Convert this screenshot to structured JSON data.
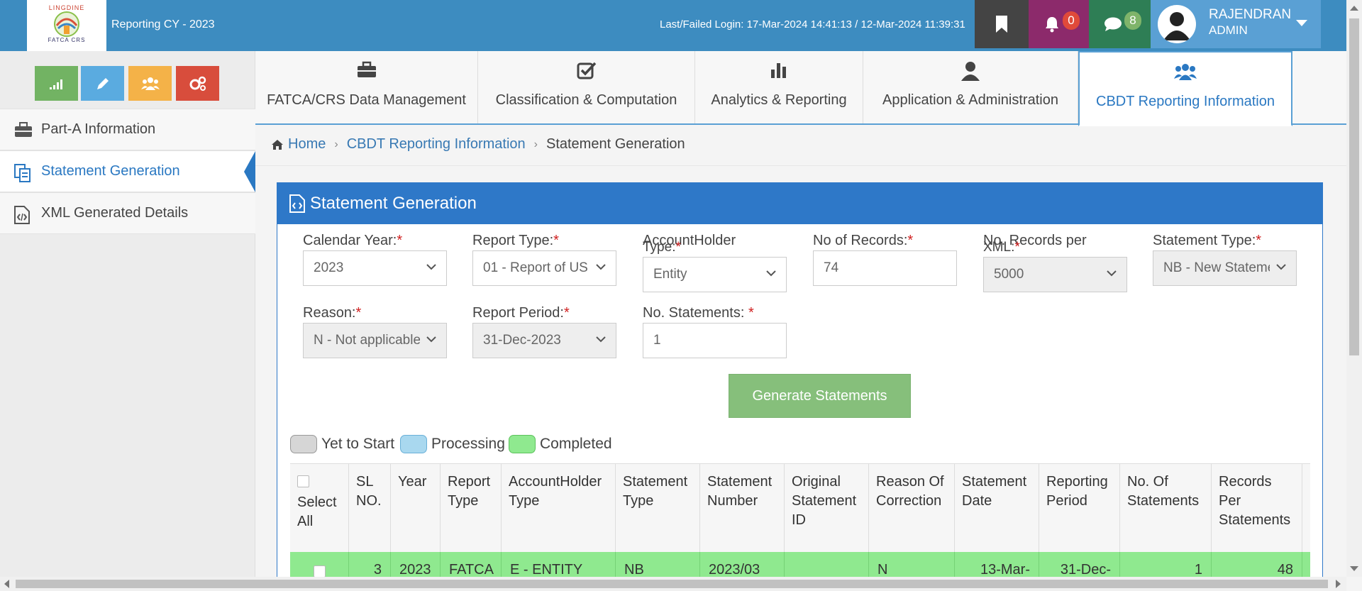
{
  "header": {
    "title": "Reporting CY - 2023",
    "login_info": "Last/Failed Login: 17-Mar-2024 14:41:13 / 12-Mar-2024 11:39:31",
    "notifications_count": "0",
    "messages_count": "8",
    "user_name": "RAJENDRAN",
    "user_role": "ADMIN",
    "logo_text_top": "LINGDINE",
    "logo_text_bottom": "FATCA CRS"
  },
  "sidebar": {
    "quick_buttons": [
      "chart-icon",
      "pencil-icon",
      "users-icon",
      "gears-icon"
    ],
    "items": [
      {
        "label": "Part-A Information",
        "icon": "briefcase-icon"
      },
      {
        "label": "Statement Generation",
        "icon": "documents-icon"
      },
      {
        "label": "XML Generated Details",
        "icon": "code-file-icon"
      }
    ]
  },
  "nav": {
    "tabs": [
      {
        "label": "FATCA/CRS Data Management",
        "icon": "briefcase-icon"
      },
      {
        "label": "Classification & Computation",
        "icon": "check-square-icon"
      },
      {
        "label": "Analytics & Reporting",
        "icon": "bar-chart-icon"
      },
      {
        "label": "Application & Administration",
        "icon": "user-icon"
      },
      {
        "label": "CBDT Reporting Information",
        "icon": "users-icon"
      }
    ]
  },
  "breadcrumb": {
    "home": "Home",
    "section": "CBDT Reporting Information",
    "current": "Statement Generation"
  },
  "panel": {
    "title": "Statement Generation",
    "fields": {
      "calendar_year": {
        "label": "Calendar Year:",
        "value": "2023"
      },
      "report_type": {
        "label": "Report Type:",
        "value": "01 - Report of US"
      },
      "accountholder_type": {
        "label_line1": "AccountHolder",
        "label_line2": "Type:",
        "value": "Entity"
      },
      "no_of_records": {
        "label": "No of Records:",
        "value": "74"
      },
      "records_per_xml": {
        "label_line1": "No. Records per",
        "label_line2": "XML:",
        "value": "5000"
      },
      "statement_type": {
        "label": "Statement Type:",
        "value": "NB - New Statement"
      },
      "reason": {
        "label": "Reason:",
        "value": "N - Not applicable"
      },
      "report_period": {
        "label": "Report Period:",
        "value": "31-Dec-2023"
      },
      "no_statements": {
        "label": "No. Statements: ",
        "value": "1"
      }
    },
    "required_mark": "*",
    "generate_button": "Generate Statements",
    "legend": [
      {
        "label": "Yet to Start",
        "color": "#d6d6d6"
      },
      {
        "label": "Processing",
        "color": "#a9d8ef"
      },
      {
        "label": "Completed",
        "color": "#8fe98f"
      }
    ]
  },
  "table": {
    "headers": [
      "Select All",
      "SL NO.",
      "Year",
      "Report Type",
      "AccountHolder Type",
      "Statement Type",
      "Statement Number",
      "Original Statement ID",
      "Reason Of Correction",
      "Statement Date",
      "Reporting Period",
      "No. Of Statements",
      "Records Per Statements"
    ],
    "rows": [
      {
        "sl_no": "3",
        "year": "2023",
        "report_type": "FATCA",
        "accountholder_type": "E - ENTITY",
        "statement_type": "NB",
        "statement_number": "2023/03",
        "original_statement_id": "",
        "reason": "N",
        "statement_date": "13-Mar-",
        "reporting_period": "31-Dec-",
        "no_of_statements": "1",
        "records_per_statement": "48"
      }
    ]
  },
  "colors": {
    "header_bg": "#3d8cc0",
    "panel_header": "#2e78c8",
    "accent": "#2a78c2",
    "completed_row": "#8fe98f",
    "generate_button": "#86bf7b"
  }
}
